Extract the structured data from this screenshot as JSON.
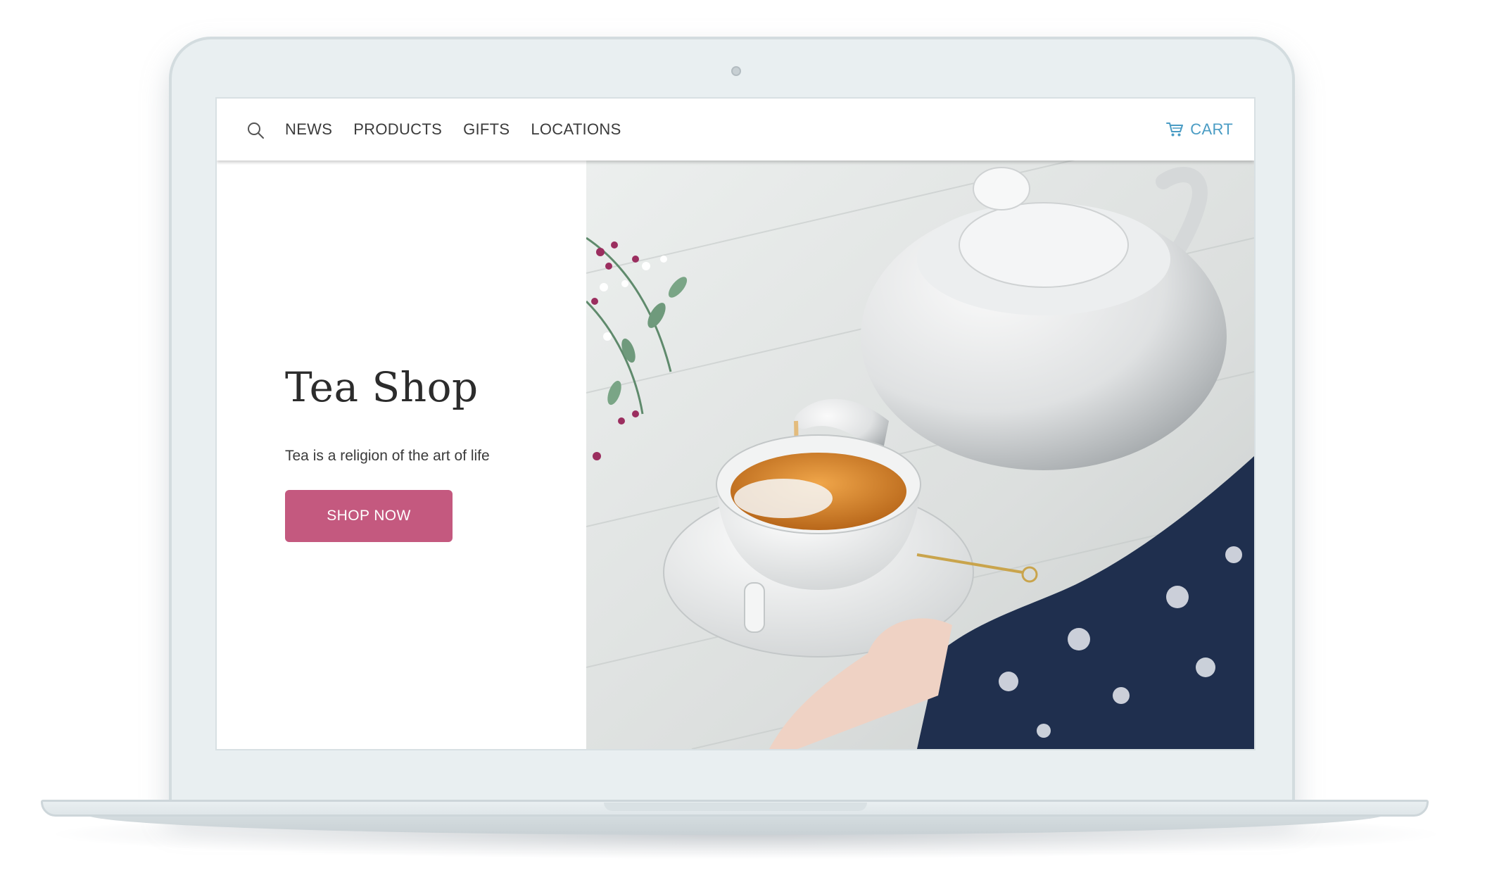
{
  "nav": {
    "search_icon": "search-icon",
    "links": [
      "NEWS",
      "PRODUCTS",
      "GIFTS",
      "LOCATIONS"
    ],
    "cart_icon": "cart-icon",
    "cart_label": "CART"
  },
  "hero": {
    "title": "Tea Shop",
    "subtitle": "Tea is a religion of the art of life",
    "button_label": "SHOP NOW",
    "image": "teapot pouring tea into cup"
  },
  "colors": {
    "accent": "#c4597f",
    "cart": "#4a9cc4",
    "text": "#2c2c2c",
    "laptop_frame": "#e9eff1"
  }
}
